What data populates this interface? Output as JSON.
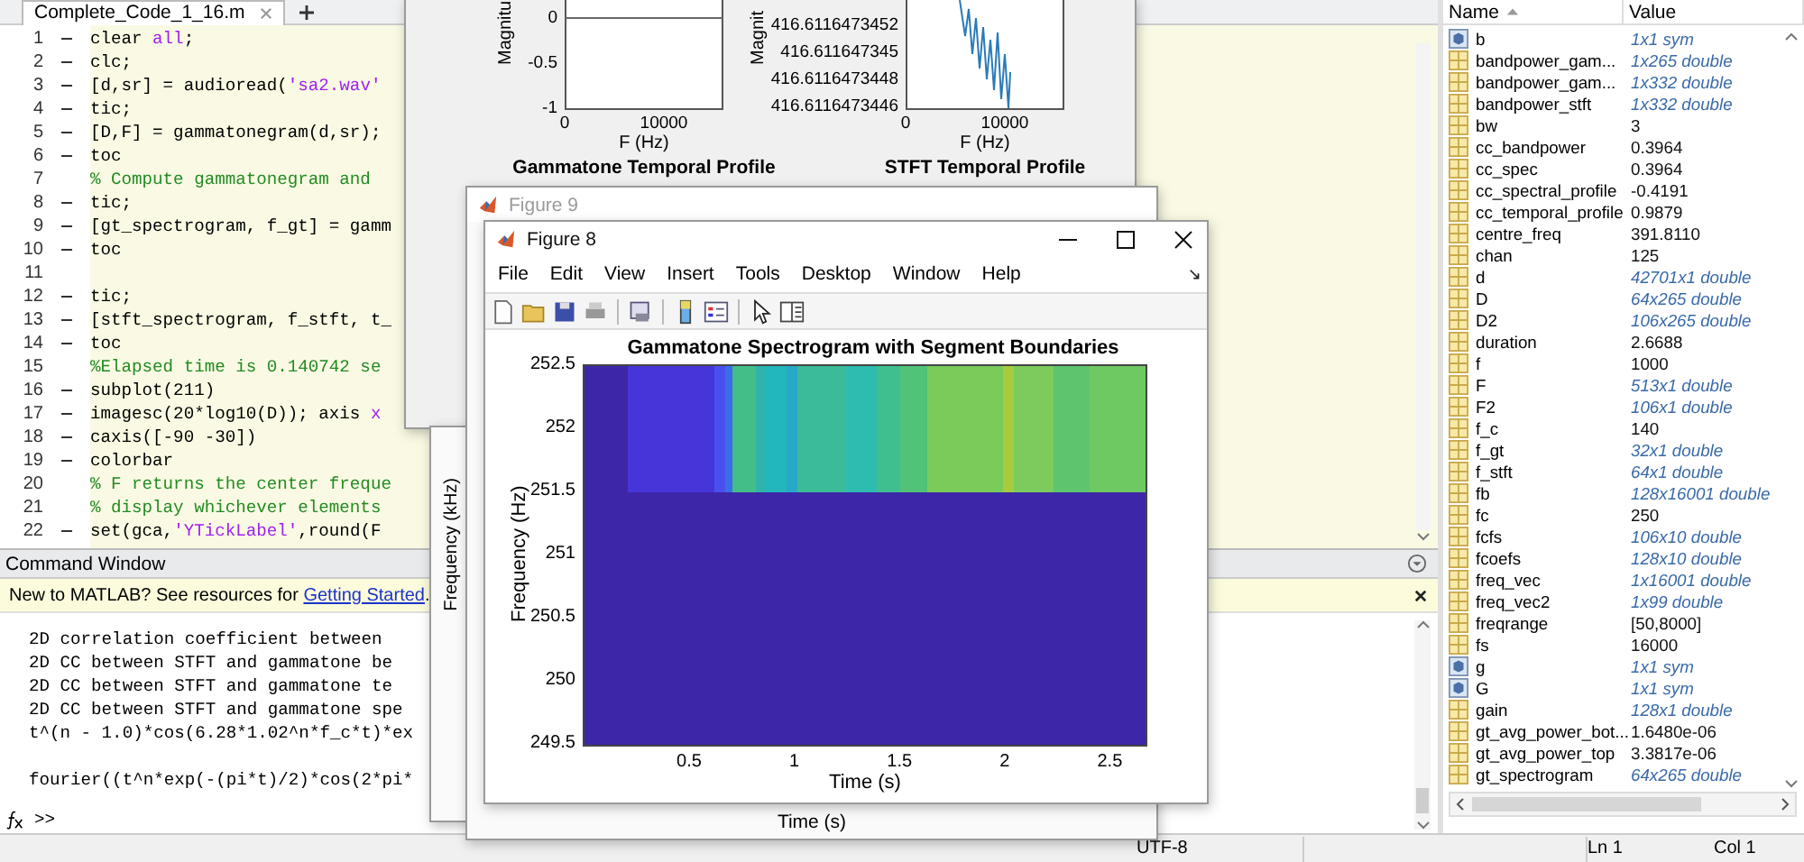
{
  "editor": {
    "tab": {
      "title": "Complete_Code_1_16.m",
      "selected": true
    },
    "lines": [
      {
        "number": "1",
        "executable": true,
        "segments": [
          {
            "text": "clear ",
            "kind": "plain"
          },
          {
            "text": "all",
            "kind": "string"
          },
          {
            "text": ";",
            "kind": "plain"
          }
        ]
      },
      {
        "number": "2",
        "executable": true,
        "segments": [
          {
            "text": "clc;",
            "kind": "plain"
          }
        ]
      },
      {
        "number": "3",
        "executable": true,
        "segments": [
          {
            "text": "[d,sr] = audioread(",
            "kind": "plain"
          },
          {
            "text": "'sa2.wav'",
            "kind": "string"
          }
        ]
      },
      {
        "number": "4",
        "executable": true,
        "segments": [
          {
            "text": "tic;",
            "kind": "plain"
          }
        ]
      },
      {
        "number": "5",
        "executable": true,
        "segments": [
          {
            "text": "[D,F] = gammatonegram(d,sr);",
            "kind": "plain"
          }
        ]
      },
      {
        "number": "6",
        "executable": true,
        "segments": [
          {
            "text": "toc",
            "kind": "plain"
          }
        ]
      },
      {
        "number": "7",
        "executable": false,
        "segments": [
          {
            "text": "% Compute gammatonegram and",
            "kind": "comment"
          }
        ]
      },
      {
        "number": "8",
        "executable": true,
        "segments": [
          {
            "text": "tic;",
            "kind": "plain"
          }
        ]
      },
      {
        "number": "9",
        "executable": true,
        "segments": [
          {
            "text": "[gt_spectrogram, f_gt] = gamm",
            "kind": "plain"
          }
        ]
      },
      {
        "number": "10",
        "executable": true,
        "segments": [
          {
            "text": "toc",
            "kind": "plain"
          }
        ]
      },
      {
        "number": "11",
        "executable": false
      },
      {
        "number": "12",
        "executable": true,
        "segments": [
          {
            "text": "tic;",
            "kind": "plain"
          }
        ]
      },
      {
        "number": "13",
        "executable": true,
        "segments": [
          {
            "text": "[stft_spectrogram, f_stft, t_",
            "kind": "plain"
          }
        ]
      },
      {
        "number": "14",
        "executable": true,
        "segments": [
          {
            "text": "toc",
            "kind": "plain"
          }
        ]
      },
      {
        "number": "15",
        "executable": false,
        "segments": [
          {
            "text": "%Elapsed time is 0.140742 se",
            "kind": "comment"
          }
        ]
      },
      {
        "number": "16",
        "executable": true,
        "segments": [
          {
            "text": "subplot(211)",
            "kind": "plain"
          }
        ]
      },
      {
        "number": "17",
        "executable": true,
        "segments": [
          {
            "text": "imagesc(20*log10(D)); axis ",
            "kind": "plain"
          },
          {
            "text": "x",
            "kind": "string"
          }
        ]
      },
      {
        "number": "18",
        "executable": true,
        "segments": [
          {
            "text": "caxis([-90 -30])",
            "kind": "plain"
          }
        ]
      },
      {
        "number": "19",
        "executable": true,
        "segments": [
          {
            "text": "colorbar",
            "kind": "plain"
          }
        ]
      },
      {
        "number": "20",
        "executable": false,
        "segments": [
          {
            "text": "% F returns the center freque",
            "kind": "comment"
          }
        ]
      },
      {
        "number": "21",
        "executable": false,
        "segments": [
          {
            "text": "% display whichever elements",
            "kind": "comment"
          }
        ]
      },
      {
        "number": "22",
        "executable": true,
        "segments": [
          {
            "text": "set(gca,",
            "kind": "plain"
          },
          {
            "text": "'YTickLabel'",
            "kind": "string"
          },
          {
            "text": ",round(F",
            "kind": "plain"
          }
        ]
      }
    ]
  },
  "command_window": {
    "title": "Command Window",
    "banner": {
      "text": "New to MATLAB? See resources for ",
      "link": "Getting Started",
      "tail": "."
    },
    "output": [
      {
        "text": "2D correlation coefficient between",
        "gap_before": false
      },
      {
        "text": "2D CC between STFT and gammatone be",
        "gap_before": false
      },
      {
        "text": "2D CC between STFT and gammatone te",
        "gap_before": false
      },
      {
        "text": "2D CC between STFT and gammatone spe",
        "gap_before": false
      },
      {
        "text": "t^(n - 1.0)*cos(6.28*1.02^n*f_c*t)*ex",
        "gap_before": false
      },
      {
        "text": "fourier((t^n*exp(-(pi*t)/2)*cos(2*pi*",
        "gap_before": true
      }
    ],
    "prompt": ">>"
  },
  "workspace": {
    "columns": [
      {
        "label": "Name",
        "sorted": true
      },
      {
        "label": "Value",
        "sorted": false
      }
    ],
    "rows": [
      {
        "name": "b",
        "value": "1x1 sym",
        "kind": "sym",
        "summary": true
      },
      {
        "name": "bandpower_gam...",
        "value": "1x265 double",
        "kind": "numeric",
        "summary": true
      },
      {
        "name": "bandpower_gam...",
        "value": "1x332 double",
        "kind": "numeric",
        "summary": true
      },
      {
        "name": "bandpower_stft",
        "value": "1x332 double",
        "kind": "numeric",
        "summary": true
      },
      {
        "name": "bw",
        "value": "3",
        "kind": "numeric",
        "summary": false
      },
      {
        "name": "cc_bandpower",
        "value": "0.3964",
        "kind": "numeric",
        "summary": false
      },
      {
        "name": "cc_spec",
        "value": "0.3964",
        "kind": "numeric",
        "summary": false
      },
      {
        "name": "cc_spectral_profile",
        "value": "-0.4191",
        "kind": "numeric",
        "summary": false
      },
      {
        "name": "cc_temporal_profile",
        "value": "0.9879",
        "kind": "numeric",
        "summary": false
      },
      {
        "name": "centre_freq",
        "value": "391.8110",
        "kind": "numeric",
        "summary": false
      },
      {
        "name": "chan",
        "value": "125",
        "kind": "numeric",
        "summary": false
      },
      {
        "name": "d",
        "value": "42701x1 double",
        "kind": "numeric",
        "summary": true
      },
      {
        "name": "D",
        "value": "64x265 double",
        "kind": "numeric",
        "summary": true
      },
      {
        "name": "D2",
        "value": "106x265 double",
        "kind": "numeric",
        "summary": true
      },
      {
        "name": "duration",
        "value": "2.6688",
        "kind": "numeric",
        "summary": false
      },
      {
        "name": "f",
        "value": "1000",
        "kind": "numeric",
        "summary": false
      },
      {
        "name": "F",
        "value": "513x1 double",
        "kind": "numeric",
        "summary": true
      },
      {
        "name": "F2",
        "value": "106x1 double",
        "kind": "numeric",
        "summary": true
      },
      {
        "name": "f_c",
        "value": "140",
        "kind": "numeric",
        "summary": false
      },
      {
        "name": "f_gt",
        "value": "32x1 double",
        "kind": "numeric",
        "summary": true
      },
      {
        "name": "f_stft",
        "value": "64x1 double",
        "kind": "numeric",
        "summary": true
      },
      {
        "name": "fb",
        "value": "128x16001 double",
        "kind": "numeric",
        "summary": true
      },
      {
        "name": "fc",
        "value": "250",
        "kind": "numeric",
        "summary": false
      },
      {
        "name": "fcfs",
        "value": "106x10 double",
        "kind": "numeric",
        "summary": true
      },
      {
        "name": "fcoefs",
        "value": "128x10 double",
        "kind": "numeric",
        "summary": true
      },
      {
        "name": "freq_vec",
        "value": "1x16001 double",
        "kind": "numeric",
        "summary": true
      },
      {
        "name": "freq_vec2",
        "value": "1x99 double",
        "kind": "numeric",
        "summary": true
      },
      {
        "name": "freqrange",
        "value": "[50,8000]",
        "kind": "numeric",
        "summary": false
      },
      {
        "name": "fs",
        "value": "16000",
        "kind": "numeric",
        "summary": false
      },
      {
        "name": "g",
        "value": "1x1 sym",
        "kind": "sym",
        "summary": true
      },
      {
        "name": "G",
        "value": "1x1 sym",
        "kind": "sym",
        "summary": true
      },
      {
        "name": "gain",
        "value": "128x1 double",
        "kind": "numeric",
        "summary": true
      },
      {
        "name": "gt_avg_power_bot...",
        "value": "1.6480e-06",
        "kind": "numeric",
        "summary": false
      },
      {
        "name": "gt_avg_power_top",
        "value": "3.3817e-06",
        "kind": "numeric",
        "summary": false
      },
      {
        "name": "gt_spectrogram",
        "value": "64x265 double",
        "kind": "numeric",
        "summary": true
      }
    ]
  },
  "status_bar": {
    "encoding": "UTF-8",
    "line": "Ln 1",
    "column": "Col 1"
  },
  "back_figure": {
    "subplots": [
      {
        "kind": "flat",
        "ylabel": "Magnitu",
        "yticks": [
          "0",
          "-0.5",
          "-1"
        ],
        "xticks": [
          "0",
          "10000"
        ],
        "xlabel": "F (Hz)",
        "title": "Gammatone Temporal Profile"
      },
      {
        "kind": "signal",
        "ylabel": "Magnit",
        "yticks": [
          "416.6116473452",
          "416.611647345",
          "416.6116473448",
          "416.6116473446"
        ],
        "xticks": [
          "0",
          "10000"
        ],
        "xlabel": "F (Hz)",
        "title": "STFT Temporal Profile"
      }
    ]
  },
  "stacked_window": {
    "ylabel": "Frequency (kHz)"
  },
  "figure_9": {
    "title": "Figure 9",
    "active": false,
    "xlabel": "Time (s)"
  },
  "figure_8": {
    "title": "Figure 8",
    "active": true,
    "menu": [
      "File",
      "Edit",
      "View",
      "Insert",
      "Tools",
      "Desktop",
      "Window",
      "Help"
    ],
    "plot": {
      "title": "Gammatone Spectrogram with Segment Boundaries",
      "ylabel": "Frequency (Hz)",
      "xlabel": "Time (s)",
      "yticks": [
        "252.5",
        "252",
        "251.5",
        "251",
        "250.5",
        "250",
        "249.5"
      ],
      "xticks": [
        "0.5",
        "1",
        "1.5",
        "2",
        "2.5"
      ]
    }
  }
}
